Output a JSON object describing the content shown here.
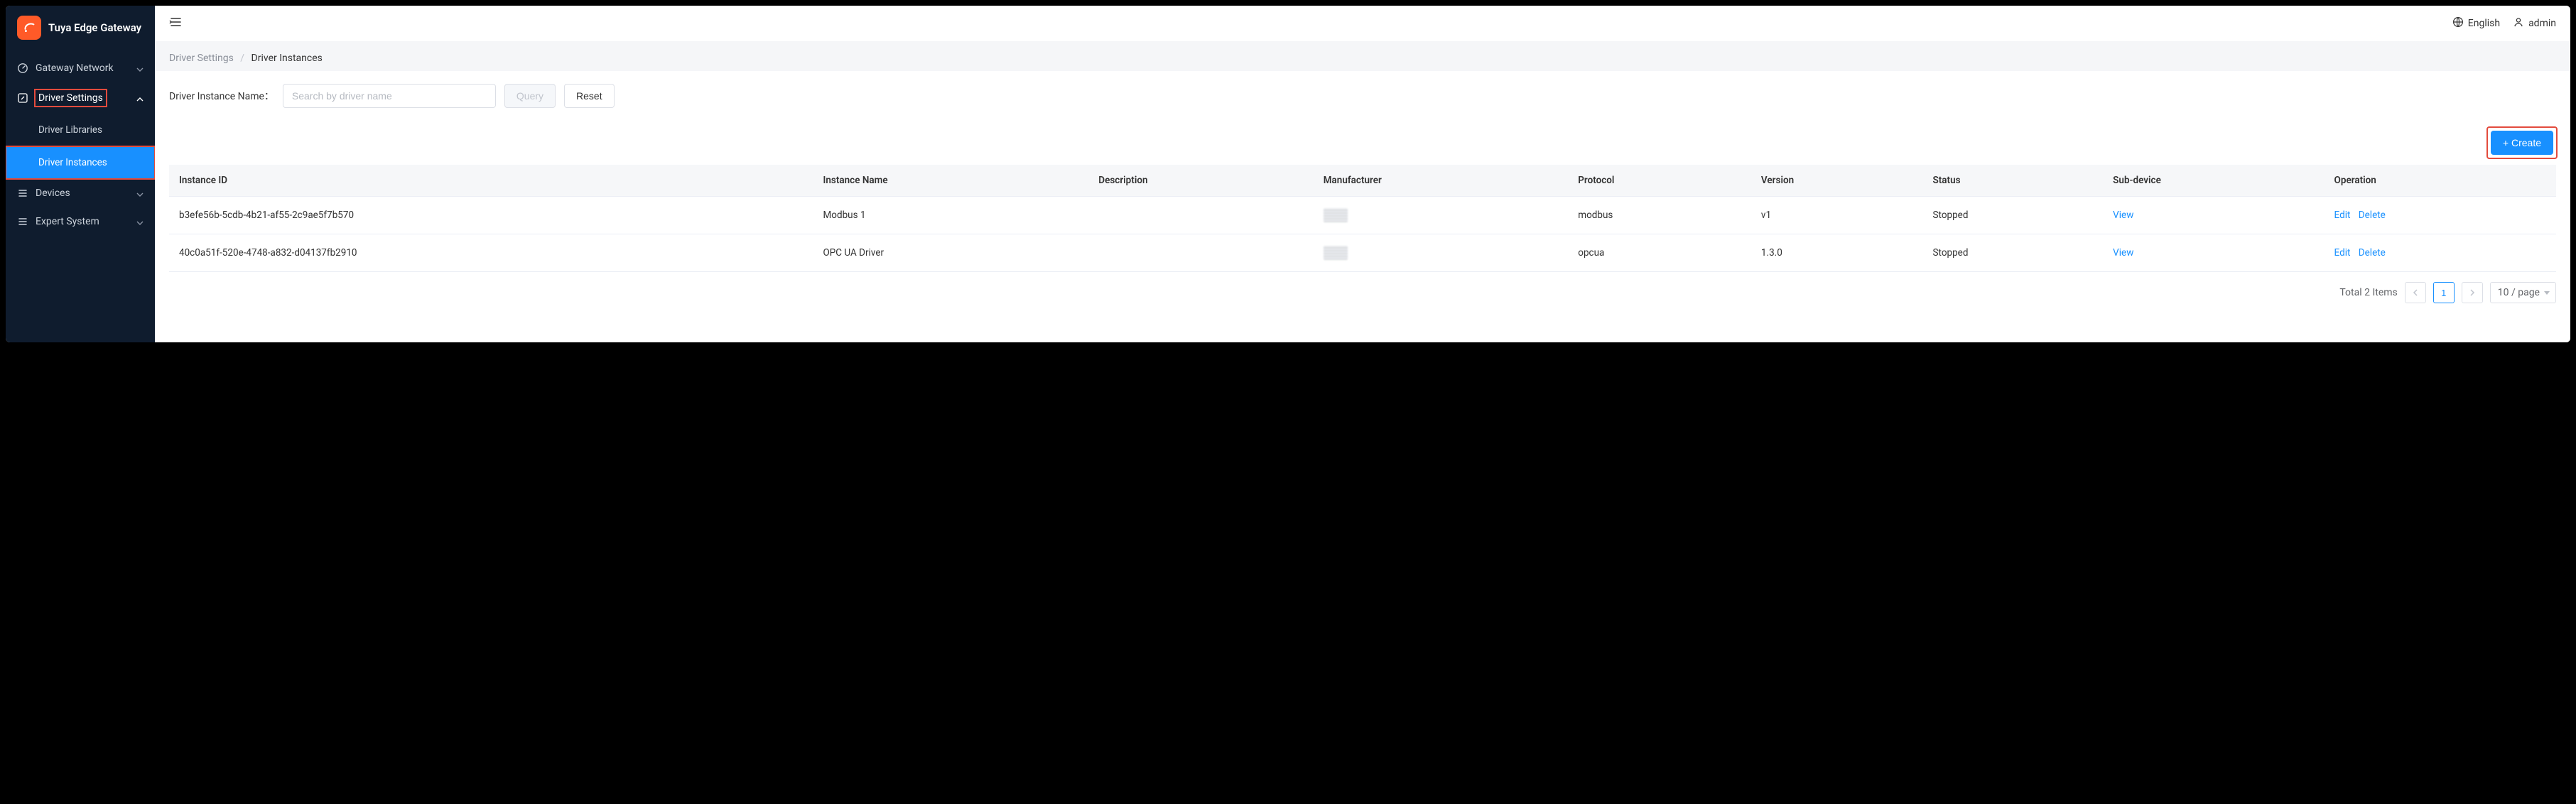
{
  "brand": {
    "title": "Tuya Edge Gateway"
  },
  "sidebar": {
    "items": [
      {
        "label": "Gateway Network",
        "expanded": false
      },
      {
        "label": "Driver Settings",
        "expanded": true,
        "children": [
          {
            "label": "Driver Libraries",
            "active": false
          },
          {
            "label": "Driver Instances",
            "active": true
          }
        ]
      },
      {
        "label": "Devices",
        "expanded": false
      },
      {
        "label": "Expert System",
        "expanded": false
      }
    ]
  },
  "topbar": {
    "language_label": "English",
    "user_label": "admin"
  },
  "breadcrumb": {
    "parent": "Driver Settings",
    "sep": "/",
    "current": "Driver Instances"
  },
  "filter": {
    "label": "Driver Instance Name：",
    "placeholder": "Search by driver name",
    "query_label": "Query",
    "reset_label": "Reset"
  },
  "create": {
    "label": "+ Create"
  },
  "table": {
    "headers": {
      "instance_id": "Instance ID",
      "instance_name": "Instance Name",
      "description": "Description",
      "manufacturer": "Manufacturer",
      "protocol": "Protocol",
      "version": "Version",
      "status": "Status",
      "sub_device": "Sub-device",
      "operation": "Operation"
    },
    "rows": [
      {
        "instance_id": "b3efe56b-5cdb-4b21-af55-2c9ae5f7b570",
        "instance_name": "Modbus 1",
        "description": "",
        "manufacturer": "",
        "protocol": "modbus",
        "version": "v1",
        "status": "Stopped",
        "view_label": "View",
        "edit_label": "Edit",
        "delete_label": "Delete"
      },
      {
        "instance_id": "40c0a51f-520e-4748-a832-d04137fb2910",
        "instance_name": "OPC UA Driver",
        "description": "",
        "manufacturer": "",
        "protocol": "opcua",
        "version": "1.3.0",
        "status": "Stopped",
        "view_label": "View",
        "edit_label": "Edit",
        "delete_label": "Delete"
      }
    ]
  },
  "pagination": {
    "total_label": "Total 2 Items",
    "current_page": "1",
    "page_size_label": "10 / page"
  }
}
